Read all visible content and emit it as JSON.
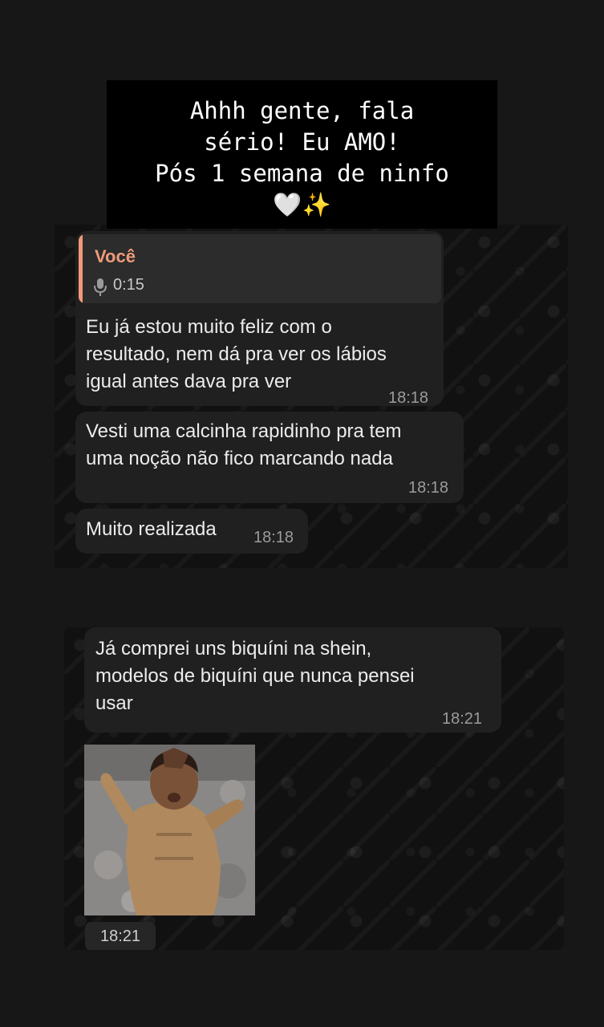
{
  "caption": {
    "line1": "Ahhh gente, fala",
    "line2": "sério! Eu AMO!",
    "line3": "Pós 1 semana de ninfo",
    "emoji_heart": "🤍",
    "emoji_sparkles": "✨"
  },
  "chat1": {
    "reply": {
      "sender": "Você",
      "audio_duration": "0:15",
      "text_line1": "Eu já estou muito feliz com o",
      "text_line2": "resultado, nem dá pra ver os lábios",
      "text_line3": "igual antes dava pra ver",
      "time": "18:18"
    },
    "message2": {
      "text_line1": "Vesti uma calcinha rapidinho pra tem",
      "text_line2": "uma noção não fico marcando nada",
      "time": "18:18"
    },
    "message3": {
      "text": "Muito realizada",
      "time": "18:18"
    }
  },
  "chat2": {
    "message1": {
      "text_line1": "Já comprei uns biquíni na shein,",
      "text_line2": "modelos de biquíni que nunca pensei",
      "text_line3": "usar",
      "time": "18:21"
    },
    "gif": {
      "time": "18:21"
    }
  },
  "colors": {
    "background": "#171717",
    "chat_wallpaper": "#111111",
    "bubble": "#202020",
    "quote_accent": "#f09a7a",
    "caption_box": "#000000"
  }
}
